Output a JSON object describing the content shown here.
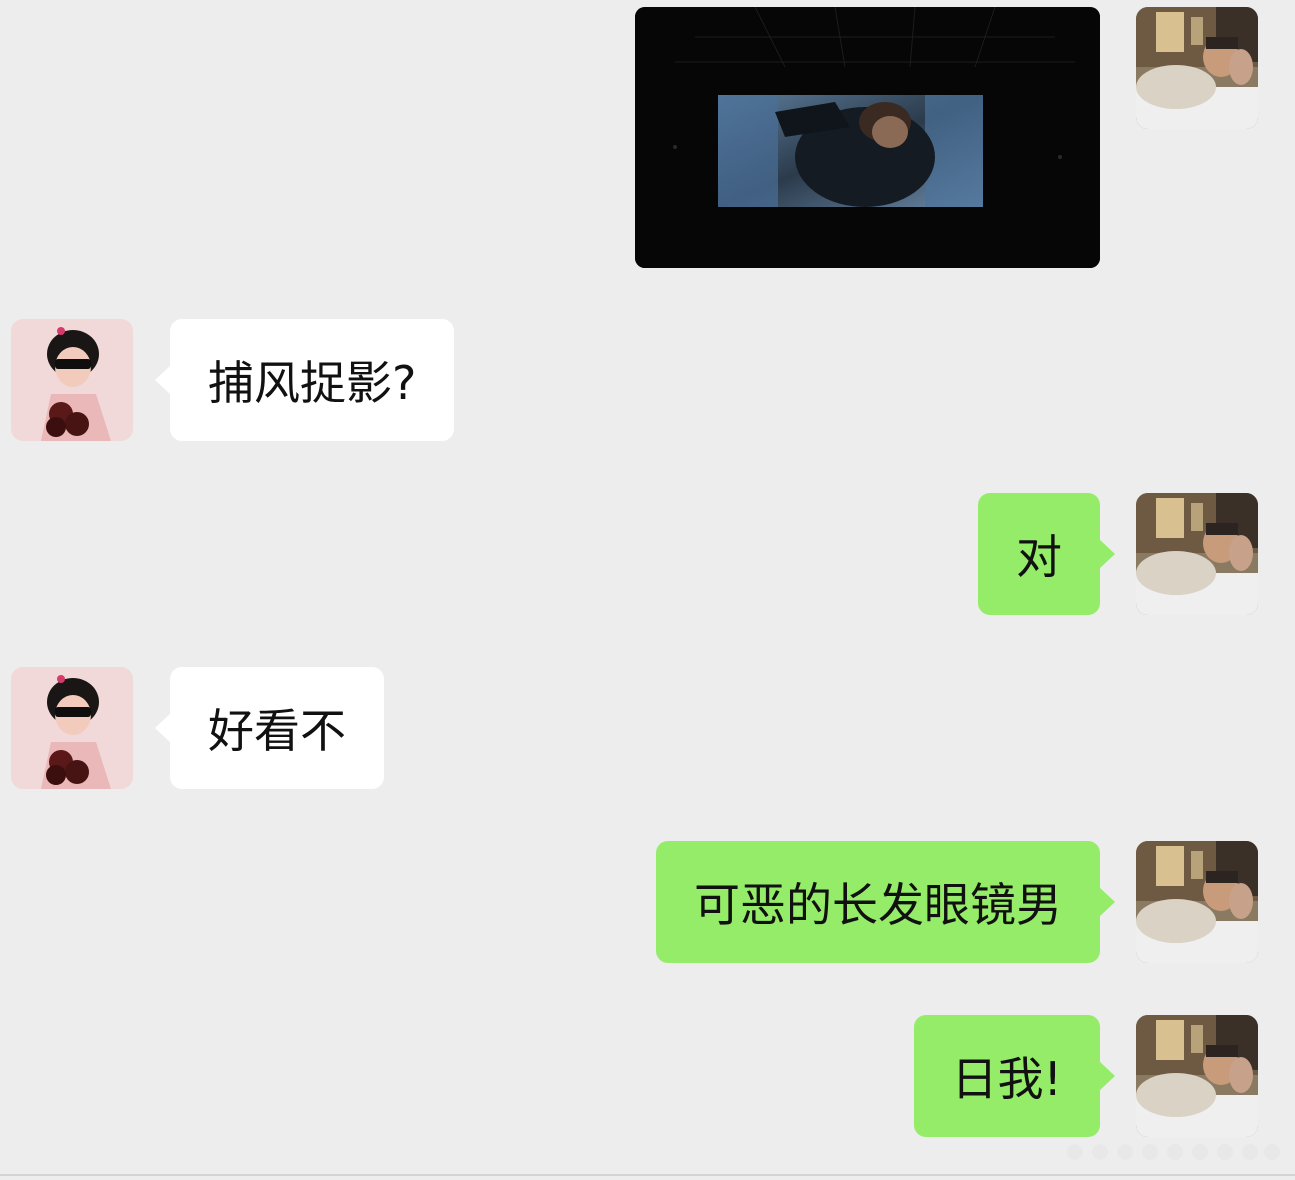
{
  "messages": [
    {
      "sender": "me",
      "type": "image",
      "image_description": "movie-screen-photo"
    },
    {
      "sender": "friend",
      "type": "text",
      "text": "捕风捉影?"
    },
    {
      "sender": "me",
      "type": "text",
      "text": "对"
    },
    {
      "sender": "friend",
      "type": "text",
      "text": "好看不"
    },
    {
      "sender": "me",
      "type": "text",
      "text": "可恶的长发眼镜男"
    },
    {
      "sender": "me",
      "type": "text",
      "text": "日我!"
    }
  ],
  "colors": {
    "background": "#ededed",
    "incoming_bubble": "#ffffff",
    "outgoing_bubble": "#95ec69",
    "text": "#111111"
  }
}
